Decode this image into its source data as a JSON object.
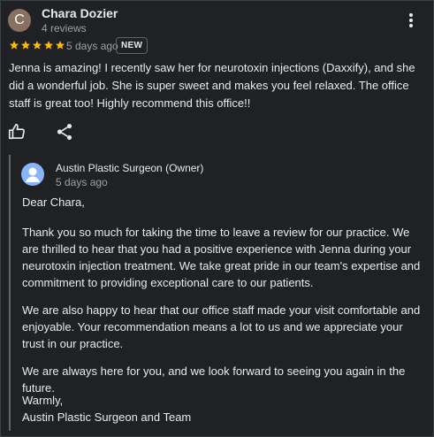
{
  "review": {
    "avatar_letter": "C",
    "avatar_color": "#8a7060",
    "reviewer_name": "Chara Dozier",
    "reviewer_meta": "4 reviews",
    "rating": 5,
    "star_color": "#fbbc04",
    "date": "5 days ago",
    "badge": "NEW",
    "text": "Jenna is amazing! I recently saw her for neurotoxin injections (Daxxify), and she did a wonderful job. She is super sweet and makes you feel relaxed. The office staff is great too! Highly recommend this office!!"
  },
  "actions": {
    "like_icon": "thumbs-up-icon",
    "share_icon": "share-icon",
    "more_icon": "more-vert-icon"
  },
  "owner_reply": {
    "name": "Austin Plastic Surgeon (Owner)",
    "date": "5 days ago",
    "avatar_color": "#8ab4f8",
    "greeting": "Dear Chara,",
    "paragraphs": [
      "Thank you so much for taking the time to leave a review for our practice. We are thrilled to hear that you had a positive experience with Jenna during your neurotoxin injection treatment. We take great pride in our team's expertise and commitment to providing exceptional care to our patients.",
      "We are also happy to hear that our office staff made your visit comfortable and enjoyable. Your recommendation means a lot to us and we appreciate your trust in our practice.",
      "We are always here for you, and we look forward to seeing you again in the future."
    ],
    "closing": "Warmly,",
    "signature": "Austin Plastic Surgeon and Team"
  }
}
